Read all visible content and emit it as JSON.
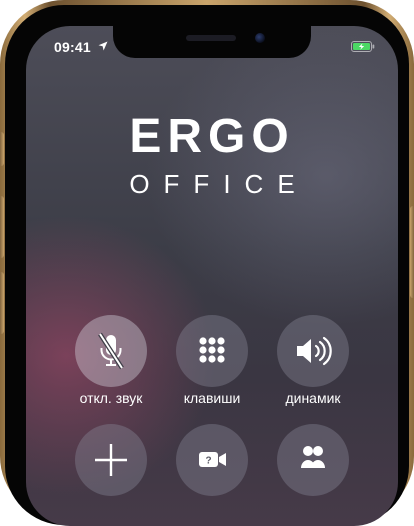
{
  "status_bar": {
    "time": "09:41",
    "location_icon": "location-arrow-icon",
    "battery_icon": "battery-charging-icon",
    "battery_color": "#4cd964"
  },
  "brand": {
    "name": "ERGO",
    "subtitle": "OFFICE"
  },
  "call_controls": [
    {
      "label": "откл. звук",
      "icon": "microphone-slash-icon",
      "state": "active"
    },
    {
      "label": "клавиши",
      "icon": "keypad-icon"
    },
    {
      "label": "динамик",
      "icon": "speaker-icon"
    },
    {
      "label": "",
      "icon": "plus-icon"
    },
    {
      "label": "",
      "icon": "facetime-icon"
    },
    {
      "label": "",
      "icon": "contacts-icon"
    }
  ],
  "colors": {
    "frame_gold": "#c9a46b",
    "button_bg": "#8c8c9b",
    "text": "#ffffff"
  }
}
